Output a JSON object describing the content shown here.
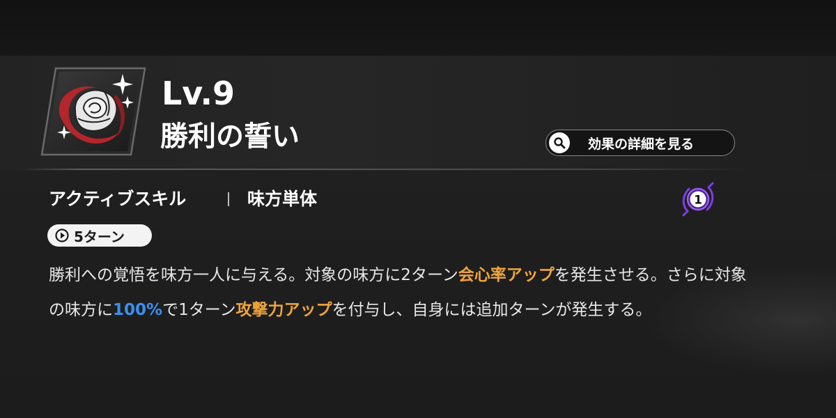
{
  "top_strip": {
    "text": "──"
  },
  "skill": {
    "level": "Lv.9",
    "name": "勝利の誓い",
    "type": "アクティブスキル",
    "target": "味方単体",
    "cost": "1",
    "turn": "5ターン"
  },
  "detail_button": {
    "label": "効果の詳細を見る"
  },
  "description": {
    "parts": [
      "勝利への覚悟を味方一人に与える。対象の味方に2ターン",
      "会心率アップ",
      "を発生させる。さらに対象の味方に",
      "100%",
      "で1ターン",
      "攻撃力アップ",
      "を付与し、自身には追加ターンが発生する。"
    ]
  },
  "colors": {
    "highlight_orange": "#f0a53a",
    "highlight_blue": "#3b8ff0",
    "cost_purple": "#7b3fe4",
    "icon_red": "#b3262b"
  },
  "icons": {
    "skill_icon": "rose-icon",
    "search": "search-icon",
    "clock": "clock-icon",
    "cost": "cost-gem-icon"
  }
}
